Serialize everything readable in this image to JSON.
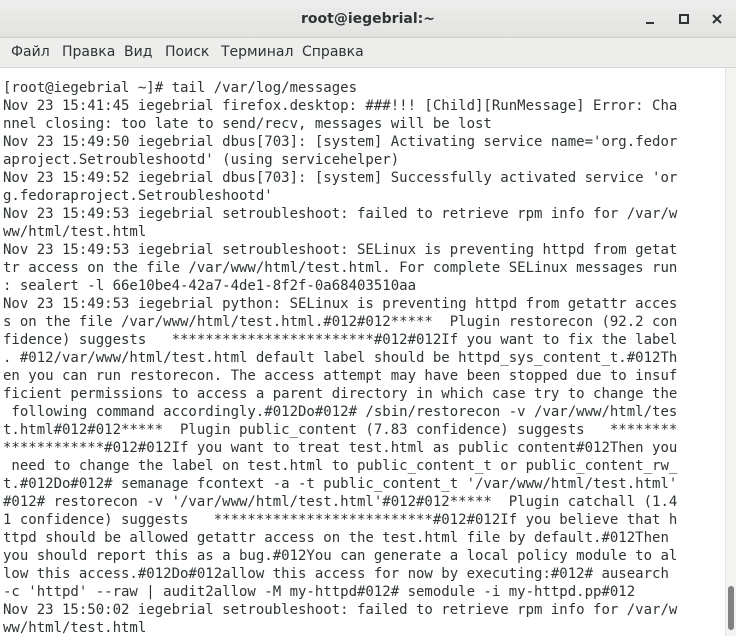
{
  "window": {
    "title": "root@iegebrial:~"
  },
  "menu": {
    "file": "Файл",
    "edit": "Правка",
    "view": "Вид",
    "search": "Поиск",
    "terminal": "Терминал",
    "help": "Справка"
  },
  "terminal": {
    "lines": [
      "[root@iegebrial ~]# tail /var/log/messages",
      "Nov 23 15:41:45 iegebrial firefox.desktop: ###!!! [Child][RunMessage] Error: Cha",
      "nnel closing: too late to send/recv, messages will be lost",
      "Nov 23 15:49:50 iegebrial dbus[703]: [system] Activating service name='org.fedor",
      "aproject.Setroubleshootd' (using servicehelper)",
      "Nov 23 15:49:52 iegebrial dbus[703]: [system] Successfully activated service 'or",
      "g.fedoraproject.Setroubleshootd'",
      "Nov 23 15:49:53 iegebrial setroubleshoot: failed to retrieve rpm info for /var/w",
      "ww/html/test.html",
      "Nov 23 15:49:53 iegebrial setroubleshoot: SELinux is preventing httpd from getat",
      "tr access on the file /var/www/html/test.html. For complete SELinux messages run",
      ": sealert -l 66e10be4-42a7-4de1-8f2f-0a68403510aa",
      "Nov 23 15:49:53 iegebrial python: SELinux is preventing httpd from getattr acces",
      "s on the file /var/www/html/test.html.#012#012*****  Plugin restorecon (92.2 con",
      "fidence) suggests   ************************#012#012If you want to fix the label",
      ". #012/var/www/html/test.html default label should be httpd_sys_content_t.#012Th",
      "en you can run restorecon. The access attempt may have been stopped due to insuf",
      "ficient permissions to access a parent directory in which case try to change the",
      " following command accordingly.#012Do#012# /sbin/restorecon -v /var/www/html/tes",
      "t.html#012#012*****  Plugin public_content (7.83 confidence) suggests   ********",
      "************#012#012If you want to treat test.html as public content#012Then you",
      " need to change the label on test.html to public_content_t or public_content_rw_",
      "t.#012Do#012# semanage fcontext -a -t public_content_t '/var/www/html/test.html'",
      "#012# restorecon -v '/var/www/html/test.html'#012#012*****  Plugin catchall (1.4",
      "1 confidence) suggests   **************************#012#012If you believe that h",
      "ttpd should be allowed getattr access on the test.html file by default.#012Then",
      "you should report this as a bug.#012You can generate a local policy module to al",
      "low this access.#012Do#012allow this access for now by executing:#012# ausearch",
      "-c 'httpd' --raw | audit2allow -M my-httpd#012# semodule -i my-httpd.pp#012",
      "Nov 23 15:50:02 iegebrial setroubleshoot: failed to retrieve rpm info for /var/w",
      "ww/html/test.html"
    ]
  }
}
